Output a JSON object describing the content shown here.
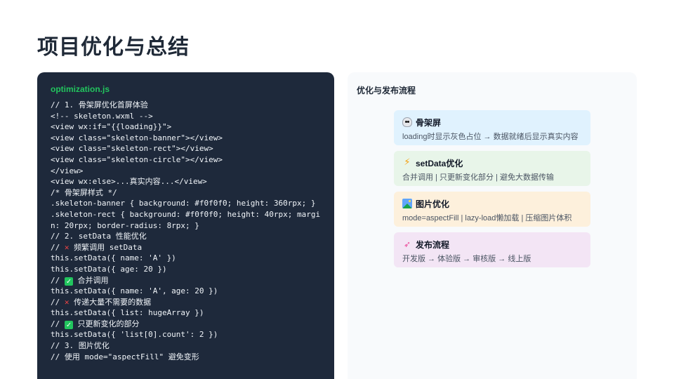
{
  "page": {
    "title": "项目优化与总结"
  },
  "code": {
    "filename": "optimization.js",
    "lines": [
      {
        "text": "// 1. 骨架屏优化首屏体验"
      },
      {
        "text": "<!-- skeleton.wxml -->"
      },
      {
        "text": "<view wx:if=\"{{loading}}\">"
      },
      {
        "text": "<view class=\"skeleton-banner\"></view>"
      },
      {
        "text": "<view class=\"skeleton-rect\"></view>"
      },
      {
        "text": "<view class=\"skeleton-circle\"></view>"
      },
      {
        "text": "</view>"
      },
      {
        "text": "<view wx:else>...真实内容...</view>"
      },
      {
        "text": "/* 骨架屏样式 */"
      },
      {
        "text": ".skeleton-banner { background: #f0f0f0; height: 360rpx; }"
      },
      {
        "text": ".skeleton-rect { background: #f0f0f0; height: 40rpx; margin: 20rpx; border-radius: 8rpx; }"
      },
      {
        "text": "// 2. setData 性能优化"
      },
      {
        "text": " 频繁调用 setData",
        "prefix": "// ",
        "mark": "cross"
      },
      {
        "text": "this.setData({ name: 'A' })"
      },
      {
        "text": "this.setData({ age: 20 })"
      },
      {
        "text": " 合并调用",
        "prefix": "// ",
        "mark": "check"
      },
      {
        "text": "this.setData({ name: 'A', age: 20 })"
      },
      {
        "text": " 传递大量不需要的数据",
        "prefix": "// ",
        "mark": "cross"
      },
      {
        "text": "this.setData({ list: hugeArray })"
      },
      {
        "text": " 只更新变化的部分",
        "prefix": "// ",
        "mark": "check"
      },
      {
        "text": "this.setData({ 'list[0].count': 2 })"
      },
      {
        "text": "// 3. 图片优化"
      },
      {
        "text": "// 使用 mode=\"aspectFill\" 避免变形"
      }
    ]
  },
  "flow": {
    "title": "优化与发布流程",
    "steps": [
      {
        "icon": "skull-icon",
        "title": "骨架屏",
        "desc": "loading时显示灰色占位 → 数据就绪后显示真实内容",
        "bg": "#e0f2fe"
      },
      {
        "icon": "lightning-icon",
        "title": "setData优化",
        "desc": "合并调用 | 只更新变化部分 | 避免大数据传输",
        "bg": "#e8f5e9"
      },
      {
        "icon": "picture-icon",
        "title": "图片优化",
        "desc": "mode=aspectFill | lazy-load懒加载 | 压缩图片体积",
        "bg": "#fdf0dc"
      },
      {
        "icon": "rocket-icon",
        "title": "发布流程",
        "desc": "开发版 → 体验版 → 审核版 → 线上版",
        "bg": "#f3e5f5"
      }
    ]
  }
}
